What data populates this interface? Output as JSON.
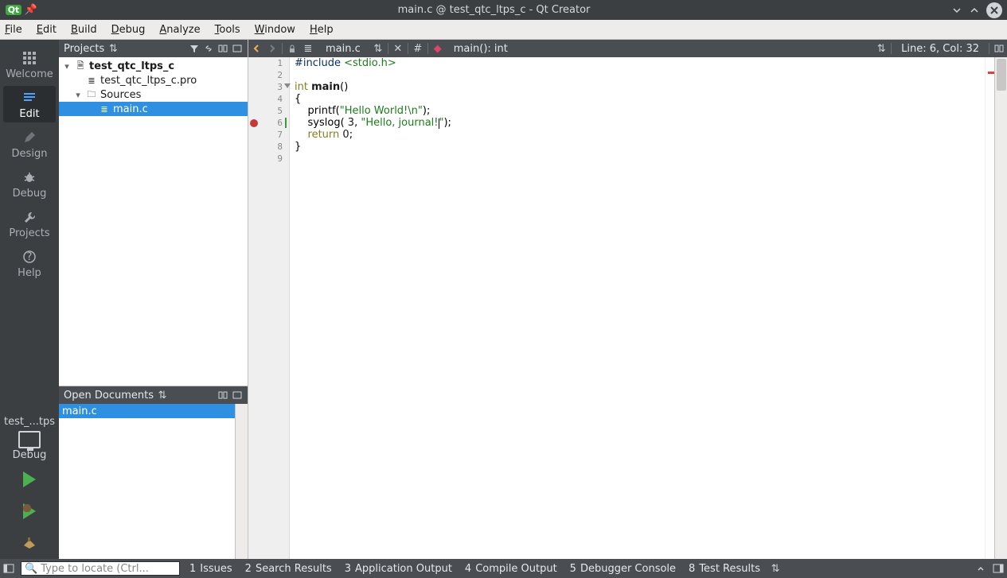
{
  "window": {
    "title": "main.c @ test_qtc_ltps_c - Qt Creator"
  },
  "menubar": [
    "File",
    "Edit",
    "Build",
    "Debug",
    "Analyze",
    "Tools",
    "Window",
    "Help"
  ],
  "modebar": {
    "items": [
      {
        "id": "welcome",
        "label": "Welcome"
      },
      {
        "id": "edit",
        "label": "Edit",
        "active": true
      },
      {
        "id": "design",
        "label": "Design"
      },
      {
        "id": "debug",
        "label": "Debug"
      },
      {
        "id": "projects",
        "label": "Projects"
      },
      {
        "id": "help",
        "label": "Help"
      }
    ],
    "kit_project": "test_...tps_c",
    "kit_mode": "Debug"
  },
  "projects_panel": {
    "title": "Projects",
    "root": {
      "label": "test_qtc_ltps_c",
      "expanded": true
    },
    "pro": {
      "label": "test_qtc_ltps_c.pro"
    },
    "sources": {
      "label": "Sources",
      "expanded": true
    },
    "file": {
      "label": "main.c",
      "selected": true
    }
  },
  "open_docs": {
    "title": "Open Documents",
    "items": [
      {
        "label": "main.c",
        "selected": true
      }
    ]
  },
  "editor_toolbar": {
    "file": "main.c",
    "symbol": "main(): int",
    "pos": "Line: 6, Col: 32"
  },
  "code": {
    "lines": [
      {
        "n": 1,
        "html": "<span class='pp'>#include</span> <span class='inc'>&lt;stdio.h&gt;</span>"
      },
      {
        "n": 2,
        "html": ""
      },
      {
        "n": 3,
        "html": "<span class='kw'>int</span> <span class='fn'>main</span>()",
        "fold": true
      },
      {
        "n": 4,
        "html": "{"
      },
      {
        "n": 5,
        "html": "    printf(<span class='str'>\"Hello World!\\n\"</span>);"
      },
      {
        "n": 6,
        "html": "    syslog( <span class='num'>3</span>, <span class='str'>\"Hello, journal!<span class='cursor'></span>\"</span>);",
        "bp": true,
        "current": true
      },
      {
        "n": 7,
        "html": "    <span class='kw'>return</span> <span class='num'>0</span>;"
      },
      {
        "n": 8,
        "html": "}"
      },
      {
        "n": 9,
        "html": ""
      }
    ]
  },
  "status": {
    "locator_placeholder": "Type to locate (Ctrl...",
    "tabs": [
      {
        "n": "1",
        "label": "Issues"
      },
      {
        "n": "2",
        "label": "Search Results"
      },
      {
        "n": "3",
        "label": "Application Output"
      },
      {
        "n": "4",
        "label": "Compile Output"
      },
      {
        "n": "5",
        "label": "Debugger Console"
      },
      {
        "n": "8",
        "label": "Test Results"
      }
    ]
  }
}
